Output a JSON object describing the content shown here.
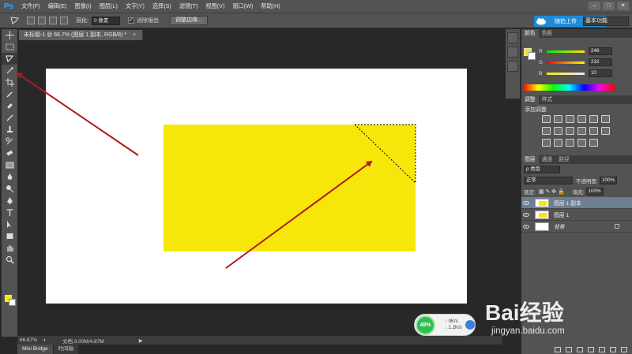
{
  "app": {
    "logo": "Ps"
  },
  "menu": [
    "文件(F)",
    "编辑(E)",
    "图像(I)",
    "图层(L)",
    "文字(Y)",
    "选择(S)",
    "滤镜(T)",
    "视图(V)",
    "窗口(W)",
    "帮助(H)"
  ],
  "options": {
    "feather_label": "羽化:",
    "feather_value": "0 像素",
    "antialias_label": "消除锯齿",
    "refine_edge_label": "调整边缘...",
    "upload_label": "随拍上传",
    "workspace": "基本功能"
  },
  "document": {
    "tab_title": "未标题-1 @ 66.7% (图层 1 副本, RGB/8) *",
    "zoom": "66.67%",
    "doc_info": "文档:3.00M/4.87M"
  },
  "bottom_tabs": [
    "Mini Bridge",
    "时间轴"
  ],
  "color_panel": {
    "tabs": [
      "颜色",
      "色板"
    ],
    "r_label": "R",
    "r_value": "246",
    "g_label": "G",
    "g_value": "232",
    "b_label": "B",
    "b_value": "10",
    "fg_color": "#f6e60a"
  },
  "adjust_panel": {
    "tabs": [
      "调整",
      "样式"
    ],
    "title": "添加调整"
  },
  "layers_panel": {
    "tabs": [
      "图层",
      "通道",
      "路径"
    ],
    "filter": "ρ 类型",
    "blend_mode": "正常",
    "opacity_label": "不透明度:",
    "opacity_value": "100%",
    "lock_label": "锁定:",
    "fill_label": "填充:",
    "fill_value": "100%",
    "layers": [
      {
        "name": "图层 1 副本"
      },
      {
        "name": "图层 1"
      },
      {
        "name": "背景"
      }
    ]
  },
  "net_widget": {
    "percent": "48%",
    "up_rate": "0K/s",
    "down_rate": "1.2K/s"
  },
  "watermark": {
    "brand": "Bai经验",
    "url": "jingyan.baidu.com"
  }
}
